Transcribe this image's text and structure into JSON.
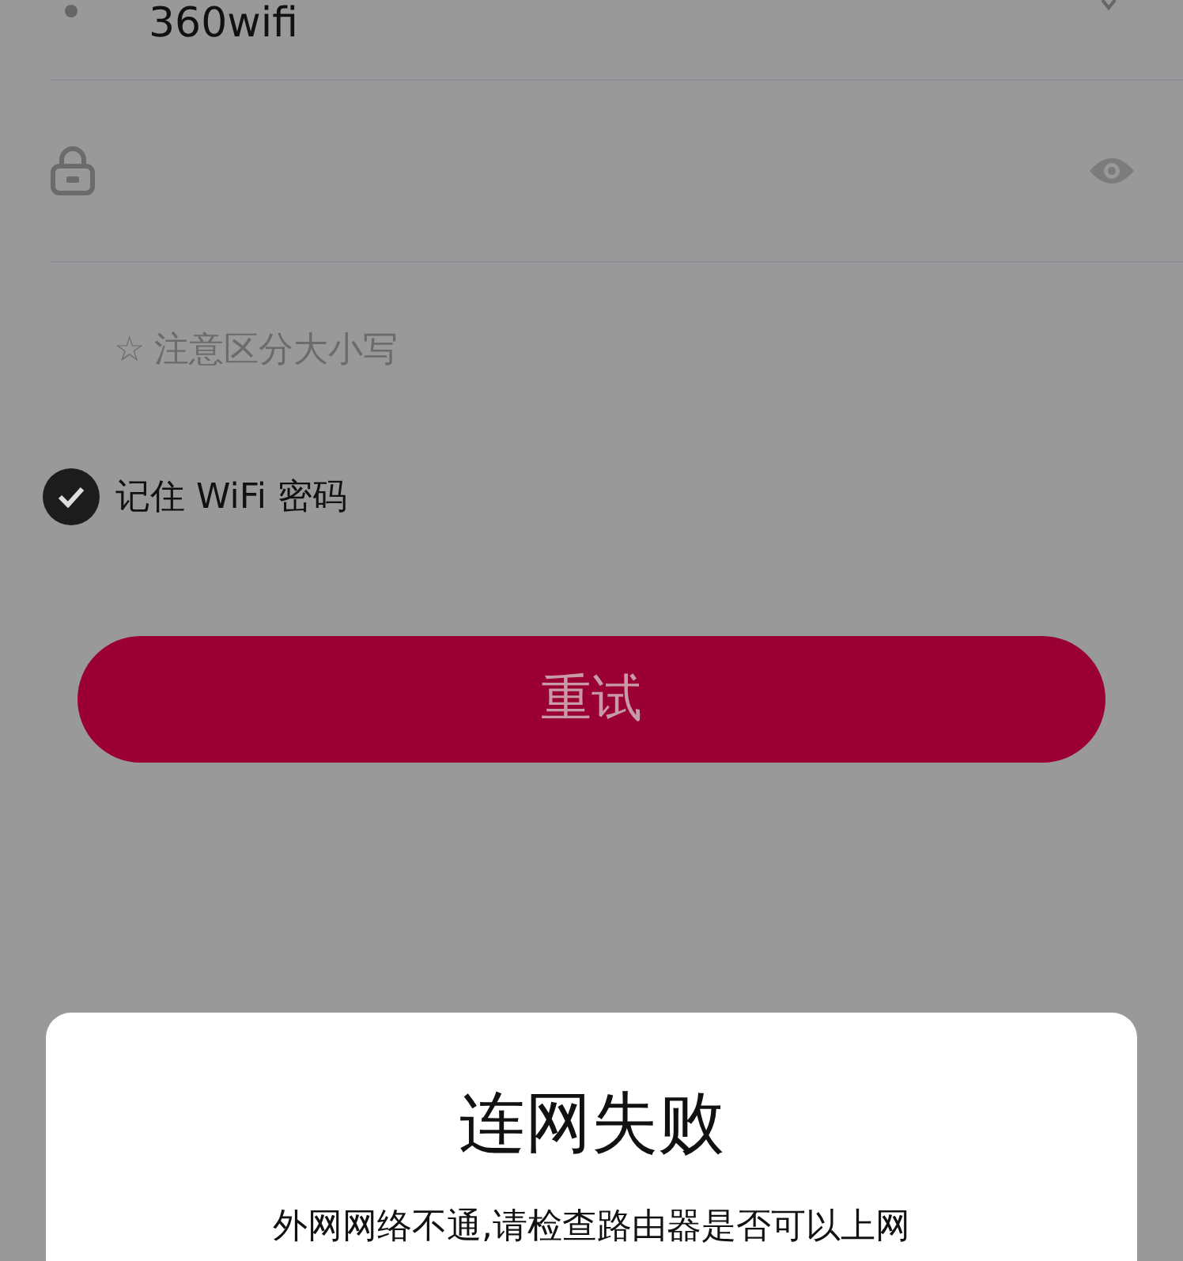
{
  "wifi_field": {
    "value": "360wifi"
  },
  "hint": {
    "icon": "☆",
    "text": "注意区分大小写"
  },
  "remember": {
    "label": "记住 WiFi 密码",
    "checked": true
  },
  "retry_button": {
    "label": "重试"
  },
  "dialog": {
    "title": "连网失败",
    "message": "外网网络不通,请检查路由器是否可以上网"
  }
}
